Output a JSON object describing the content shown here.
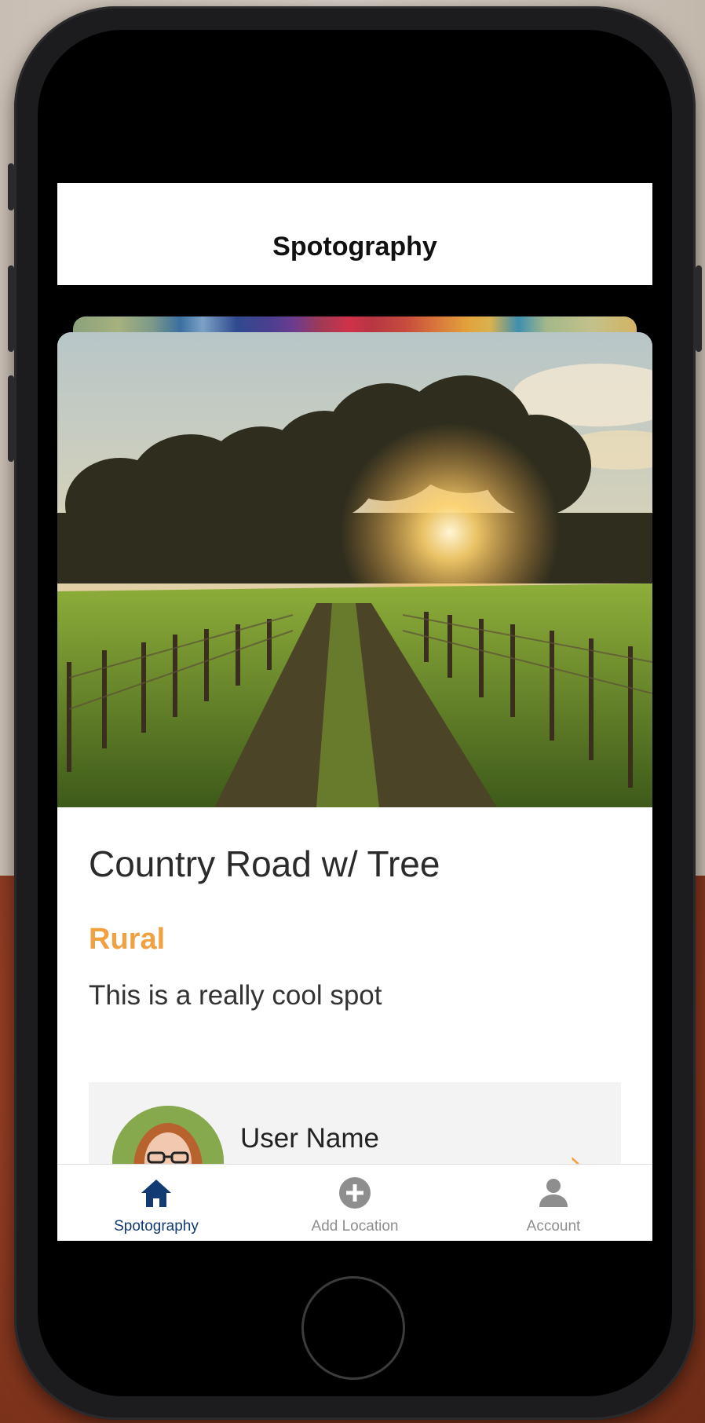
{
  "app": {
    "title": "Spotography"
  },
  "spot": {
    "title": "Country Road w/ Tree",
    "category": "Rural",
    "description": "This is a really cool spot"
  },
  "user": {
    "name": "User Name"
  },
  "tabs": [
    {
      "label": "Spotography",
      "icon": "home-icon",
      "active": true
    },
    {
      "label": "Add Location",
      "icon": "plus-circle-icon",
      "active": false
    },
    {
      "label": "Account",
      "icon": "person-icon",
      "active": false
    }
  ],
  "colors": {
    "accent": "#f0a242",
    "tab_active": "#123a73",
    "tab_inactive": "#8e8e8e"
  }
}
